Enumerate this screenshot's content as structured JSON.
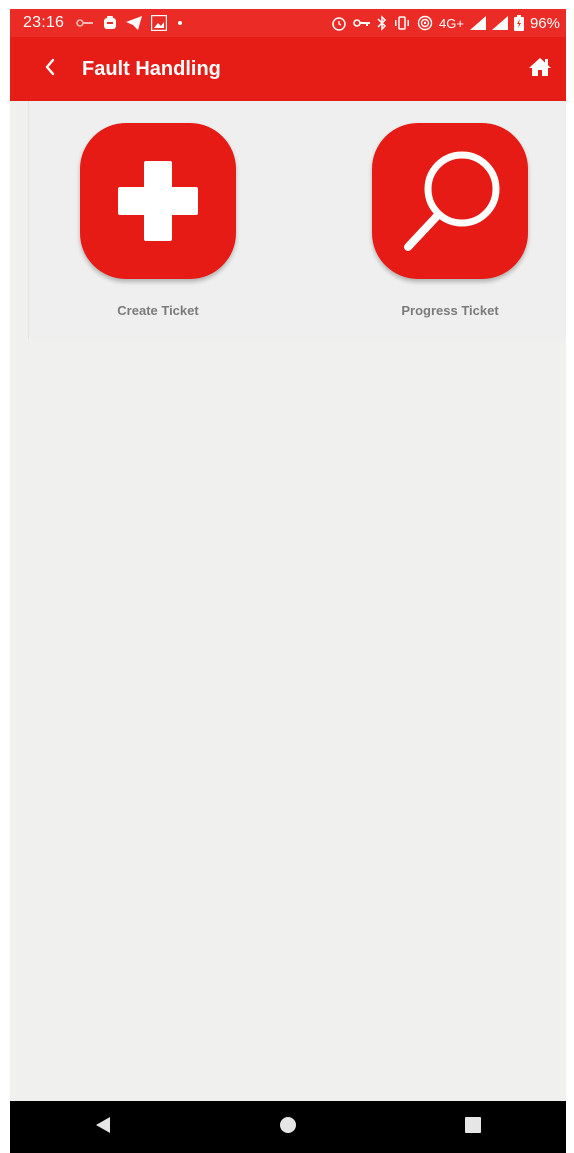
{
  "status_bar": {
    "time": "23:16",
    "battery_percent": "96%",
    "network": "4G+",
    "left_icons": [
      "key-icon",
      "notification-app-icon",
      "telegram-icon",
      "gallery-icon",
      "dot-icon"
    ],
    "right_icons": [
      "alarm-icon",
      "vpn-key-icon",
      "bluetooth-icon",
      "vibrate-icon",
      "hotspot-icon",
      "signal-icon",
      "signal-icon",
      "battery-icon"
    ],
    "color": "#ea2b26"
  },
  "app_bar": {
    "title": "Fault Handling",
    "color": "#e61d17",
    "back_icon": "chevron-left-icon",
    "home_icon": "home-icon"
  },
  "tiles": [
    {
      "label": "Create Ticket",
      "icon": "plus-icon"
    },
    {
      "label": "Progress Ticket",
      "icon": "magnifier-icon"
    }
  ],
  "nav_bar": {
    "buttons": [
      "back-triangle-icon",
      "home-circle-icon",
      "recents-square-icon"
    ]
  }
}
